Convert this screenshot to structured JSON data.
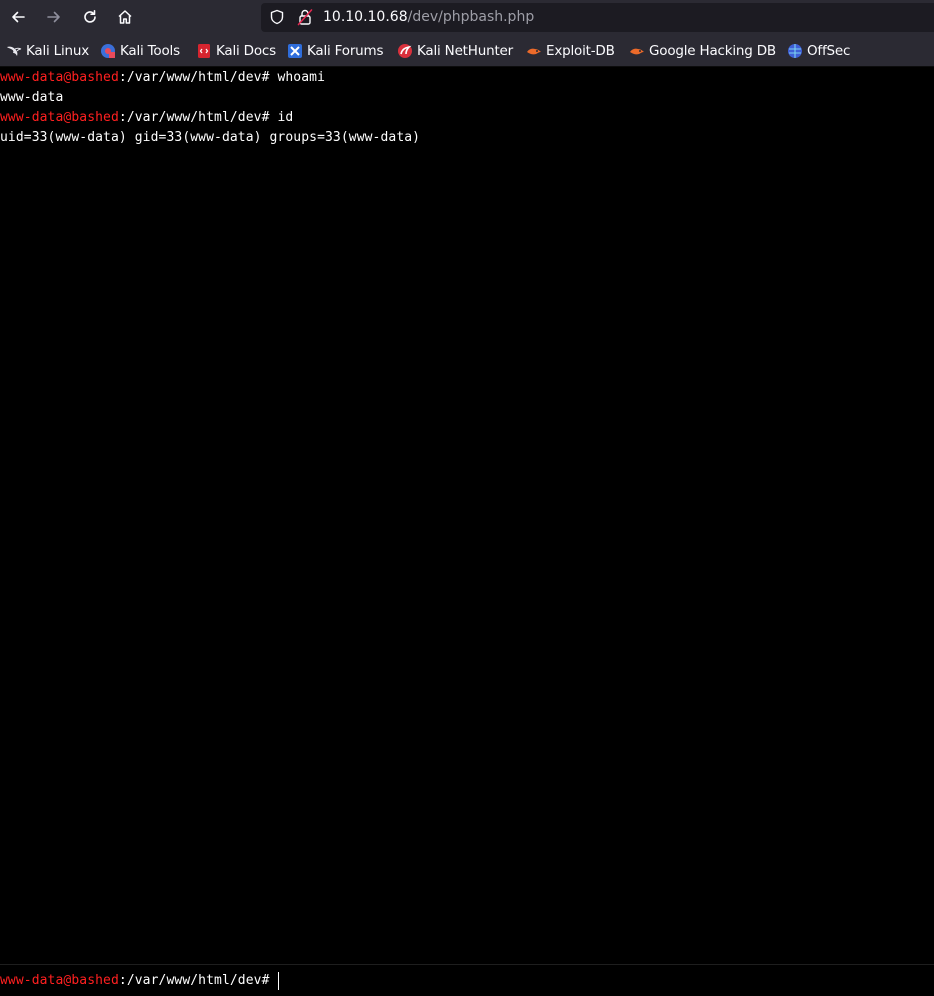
{
  "browser": {
    "nav": {
      "back_icon": "arrow-left-icon",
      "forward_icon": "arrow-right-icon",
      "reload_icon": "reload-icon",
      "home_icon": "home-icon"
    },
    "url": {
      "host": "10.10.10.68",
      "path": "/dev/phpbash.php"
    },
    "bookmarks": [
      {
        "label": "Kali Linux",
        "icon": "kali-dragon-icon"
      },
      {
        "label": "Kali Tools",
        "icon": "kali-tools-icon"
      },
      {
        "label": "Kali Docs",
        "icon": "kali-docs-icon"
      },
      {
        "label": "Kali Forums",
        "icon": "kali-forums-icon"
      },
      {
        "label": "Kali NetHunter",
        "icon": "kali-nethunter-icon"
      },
      {
        "label": "Exploit-DB",
        "icon": "exploit-db-icon"
      },
      {
        "label": "Google Hacking DB",
        "icon": "ghdb-icon"
      },
      {
        "label": "OffSec",
        "icon": "offsec-icon"
      }
    ]
  },
  "terminal": {
    "prompt_user": "www-data@bashed",
    "prompt_path": ":/var/www/html/dev# ",
    "history": [
      {
        "command": "whoami",
        "output": "www-data"
      },
      {
        "command": "id",
        "output": "uid=33(www-data) gid=33(www-data) groups=33(www-data)"
      }
    ],
    "input_value": ""
  },
  "colors": {
    "prompt_user": "#ff2020",
    "text": "#ffffff",
    "background": "#000000",
    "toolbar": "#2b2a33"
  }
}
